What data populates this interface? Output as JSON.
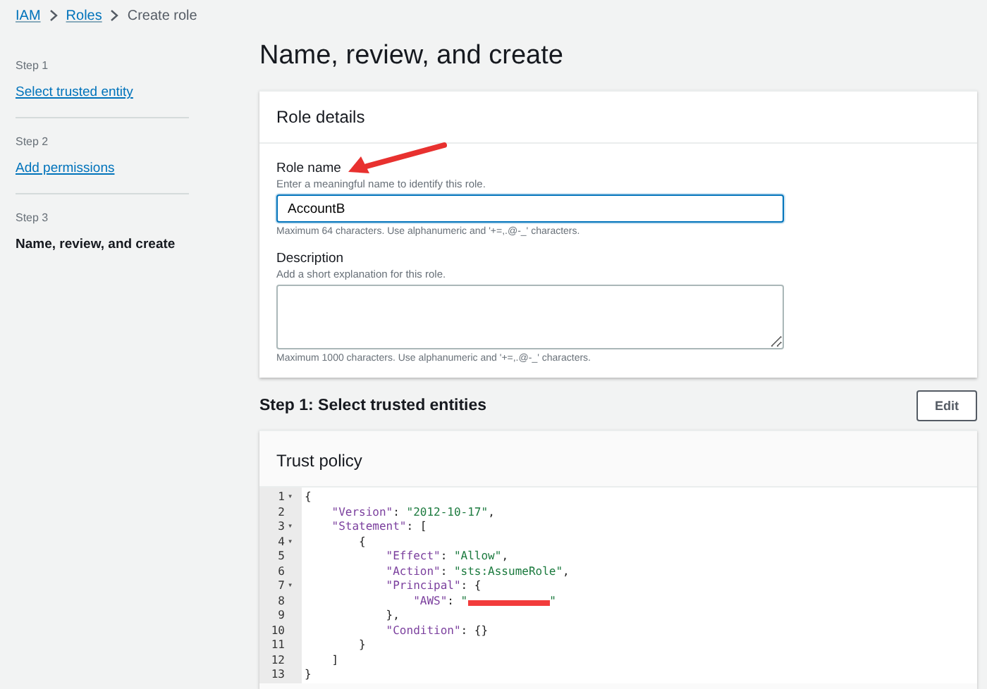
{
  "breadcrumb": [
    {
      "label": "IAM",
      "link": true
    },
    {
      "label": "Roles",
      "link": true
    },
    {
      "label": "Create role",
      "link": false
    }
  ],
  "steps": [
    {
      "step": "Step 1",
      "label": "Select trusted entity",
      "selected": false
    },
    {
      "step": "Step 2",
      "label": "Add permissions",
      "selected": false
    },
    {
      "step": "Step 3",
      "label": "Name, review, and create",
      "selected": true
    }
  ],
  "page_title": "Name, review, and create",
  "role_details": {
    "title": "Role details",
    "role_name": {
      "label": "Role name",
      "hint": "Enter a meaningful name to identify this role.",
      "value": "AccountB",
      "constraint": "Maximum 64 characters. Use alphanumeric and '+=,.@-_' characters."
    },
    "description": {
      "label": "Description",
      "hint": "Add a short explanation for this role.",
      "constraint": "Maximum 1000 characters. Use alphanumeric and '+=,.@-_' characters."
    }
  },
  "trusted_entities": {
    "title": "Step 1: Select trusted entities",
    "edit_button": "Edit",
    "panel_title": "Trust policy",
    "code_lines": [
      {
        "number": "1",
        "fold_marker": "▾",
        "tokens": [
          {
            "kind": "punct",
            "text": "{"
          }
        ]
      },
      {
        "number": "2",
        "tokens": [
          {
            "kind": "key",
            "text": "    \"Version\""
          },
          {
            "kind": "punct",
            "text": ": "
          },
          {
            "kind": "string",
            "text": "\"2012-10-17\""
          },
          {
            "kind": "punct",
            "text": ","
          }
        ]
      },
      {
        "number": "3",
        "fold_marker": "▾",
        "tokens": [
          {
            "kind": "key",
            "text": "    \"Statement\""
          },
          {
            "kind": "punct",
            "text": ": ["
          }
        ]
      },
      {
        "number": "4",
        "fold_marker": "▾",
        "tokens": [
          {
            "kind": "punct",
            "text": "        {"
          }
        ]
      },
      {
        "number": "5",
        "tokens": [
          {
            "kind": "key",
            "text": "            \"Effect\""
          },
          {
            "kind": "punct",
            "text": ": "
          },
          {
            "kind": "string",
            "text": "\"Allow\""
          },
          {
            "kind": "punct",
            "text": ","
          }
        ]
      },
      {
        "number": "6",
        "tokens": [
          {
            "kind": "key",
            "text": "            \"Action\""
          },
          {
            "kind": "punct",
            "text": ": "
          },
          {
            "kind": "string",
            "text": "\"sts:AssumeRole\""
          },
          {
            "kind": "punct",
            "text": ","
          }
        ]
      },
      {
        "number": "7",
        "fold_marker": "▾",
        "tokens": [
          {
            "kind": "key",
            "text": "            \"Principal\""
          },
          {
            "kind": "punct",
            "text": ": {"
          }
        ]
      },
      {
        "number": "8",
        "tokens": [
          {
            "kind": "key",
            "text": "                \"AWS\""
          },
          {
            "kind": "punct",
            "text": ": "
          },
          {
            "kind": "string",
            "text": "\""
          },
          {
            "kind": "redaction"
          },
          {
            "kind": "string",
            "text": "\""
          }
        ]
      },
      {
        "number": "9",
        "tokens": [
          {
            "kind": "punct",
            "text": "            },"
          }
        ]
      },
      {
        "number": "10",
        "tokens": [
          {
            "kind": "key",
            "text": "            \"Condition\""
          },
          {
            "kind": "punct",
            "text": ": {}"
          }
        ]
      },
      {
        "number": "11",
        "tokens": [
          {
            "kind": "punct",
            "text": "        }"
          }
        ]
      },
      {
        "number": "12",
        "tokens": [
          {
            "kind": "punct",
            "text": "    ]"
          }
        ]
      },
      {
        "number": "13",
        "tokens": [
          {
            "kind": "punct",
            "text": "}"
          }
        ]
      }
    ]
  }
}
